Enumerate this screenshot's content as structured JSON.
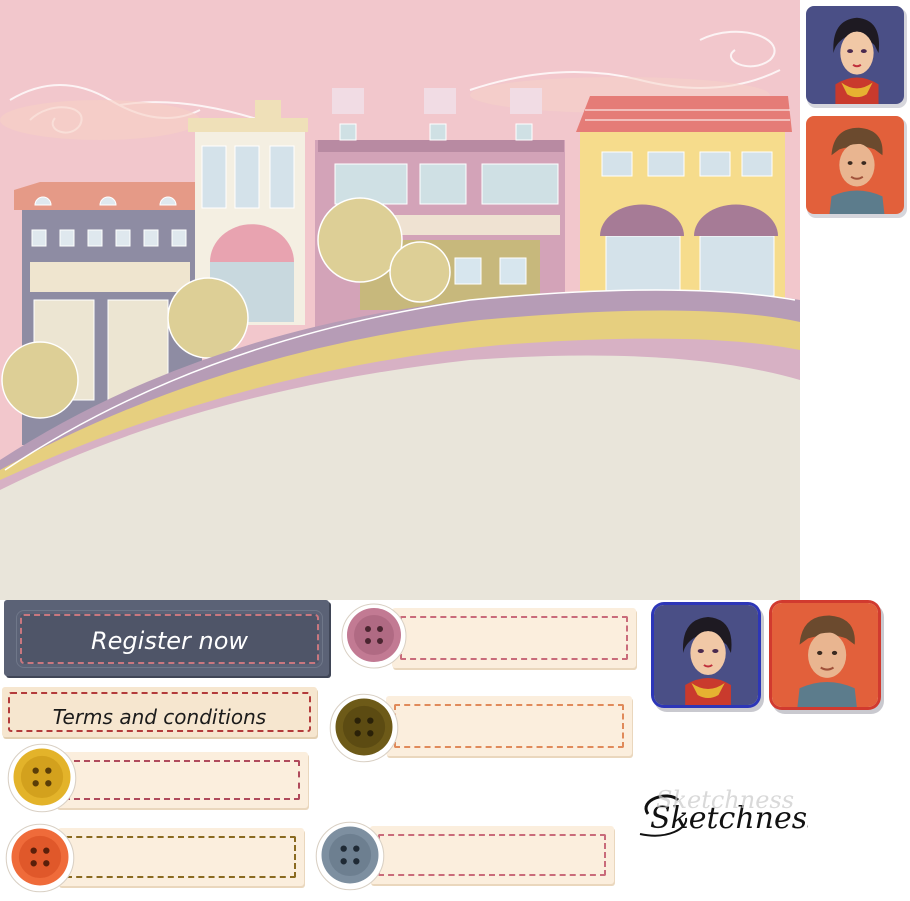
{
  "buttons": {
    "register_label": "Register now",
    "terms_label": "Terms and conditions"
  },
  "icons": {
    "female_avatar": "female-avatar-icon",
    "male_avatar": "male-avatar-icon",
    "logo": "sketchness-logo"
  },
  "colors": {
    "sky": "#f2c7cc",
    "ground": "#e9e5da",
    "register_bg": "#5b6276",
    "terms_border": "#b33b3b",
    "button_pink": "#c27a93",
    "button_olive": "#6d5a18",
    "button_yellow": "#e3b32a",
    "button_orange": "#ef6b3a",
    "button_blue": "#7d8fa0",
    "avatar_blue_frame": "#2d36b8",
    "avatar_red_frame": "#d13a2f"
  },
  "logo_text": "Sketchness"
}
